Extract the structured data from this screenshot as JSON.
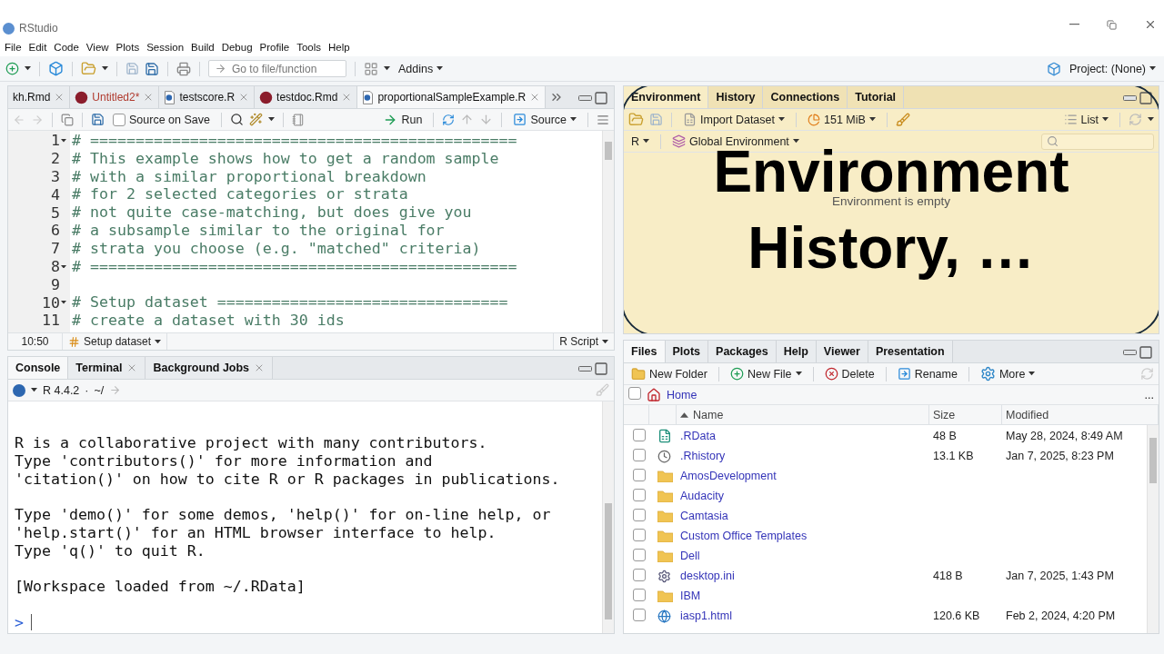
{
  "window": {
    "title": "RStudio"
  },
  "menu": [
    "File",
    "Edit",
    "Code",
    "View",
    "Plots",
    "Session",
    "Build",
    "Debug",
    "Profile",
    "Tools",
    "Help"
  ],
  "toolbar": {
    "goto_placeholder": "Go to file/function",
    "addins": "Addins",
    "project": "Project: (None)"
  },
  "editor": {
    "tabs": [
      {
        "label": "kh.Rmd",
        "selected": false,
        "modified": false
      },
      {
        "label": "Untitled2*",
        "kind": "rmd",
        "selected": false,
        "modified": true
      },
      {
        "label": "testscore.R",
        "kind": "r",
        "selected": false,
        "modified": false
      },
      {
        "label": "testdoc.Rmd",
        "kind": "rmd",
        "selected": false,
        "modified": false
      },
      {
        "label": "proportionalSampleExample.R",
        "kind": "r",
        "selected": true,
        "modified": false
      }
    ],
    "source_on_save": {
      "label": "Source on Save",
      "checked": false
    },
    "run": "Run",
    "source": "Source",
    "lines": [
      {
        "number": "1",
        "text": "# ===============================================",
        "fold": true
      },
      {
        "number": "2",
        "text": "# This example shows how to get a random sample",
        "fold": false
      },
      {
        "number": "3",
        "text": "# with a similar proportional breakdown",
        "fold": false
      },
      {
        "number": "4",
        "text": "# for 2 selected categories or strata",
        "fold": false
      },
      {
        "number": "5",
        "text": "# not quite case-matching, but does give you",
        "fold": false
      },
      {
        "number": "6",
        "text": "# a subsample similar to the original for",
        "fold": false
      },
      {
        "number": "7",
        "text": "# strata you choose (e.g. \"matched\" criteria)",
        "fold": false
      },
      {
        "number": "8",
        "text": "# ===============================================",
        "fold": true
      },
      {
        "number": "9",
        "fold": false
      },
      {
        "number": "10",
        "text": "# Setup dataset ================================",
        "fold": true
      },
      {
        "number": "11",
        "text": "# create a dataset with 30 ids",
        "fold": false
      }
    ],
    "status": {
      "position": "10:50",
      "section": "Setup dataset",
      "type": "R Script"
    }
  },
  "console": {
    "tabs": [
      {
        "label": "Console",
        "selected": true,
        "closable": false
      },
      {
        "label": "Terminal",
        "selected": false,
        "closable": true
      },
      {
        "label": "Background Jobs",
        "selected": false,
        "closable": true
      }
    ],
    "version": "R 4.4.2",
    "separator": "·",
    "path": "~/",
    "paragraphs": [
      [
        "R is a collaborative project with many contributors.",
        "Type 'contributors()' for more information and",
        "'citation()' on how to cite R or R packages in publications."
      ],
      [
        "Type 'demo()' for some demos, 'help()' for on-line help, or",
        "'help.start()' for an HTML browser interface to help.",
        "Type 'q()' to quit R."
      ],
      [
        "[Workspace loaded from ~/.RData]"
      ]
    ],
    "prompt": ">"
  },
  "environment": {
    "tabs": [
      {
        "label": "Environment",
        "selected": true
      },
      {
        "label": "History",
        "selected": false
      },
      {
        "label": "Connections",
        "selected": false
      },
      {
        "label": "Tutorial",
        "selected": false
      }
    ],
    "import": "Import Dataset",
    "memory": "151 MiB",
    "view": "List",
    "language": "R",
    "scope": "Global Environment",
    "empty": "Environment is empty"
  },
  "callout": {
    "lines": [
      "Environment",
      "History, …"
    ]
  },
  "files": {
    "tabs": [
      {
        "label": "Files",
        "selected": true
      },
      {
        "label": "Plots",
        "selected": false
      },
      {
        "label": "Packages",
        "selected": false
      },
      {
        "label": "Help",
        "selected": false
      },
      {
        "label": "Viewer",
        "selected": false
      },
      {
        "label": "Presentation",
        "selected": false
      }
    ],
    "actions": [
      {
        "label": "New Folder",
        "kind": "new-folder"
      },
      {
        "label": "New File",
        "kind": "new-file"
      },
      {
        "label": "Delete",
        "kind": "delete"
      },
      {
        "label": "Rename",
        "kind": "rename"
      },
      {
        "label": "More",
        "kind": "more"
      }
    ],
    "path": "Home",
    "more_path": "...",
    "select_all": false,
    "columns": [
      "Name",
      "Size",
      "Modified"
    ],
    "rows": [
      {
        "name": ".RData",
        "size": "48 B",
        "modified": "May 28, 2024, 8:49 AM",
        "kind": "rdata",
        "checked": false
      },
      {
        "name": ".Rhistory",
        "size": "13.1 KB",
        "modified": "Jan 7, 2025, 8:23 PM",
        "kind": "history",
        "checked": false
      },
      {
        "name": "AmosDevelopment",
        "kind": "folder",
        "checked": false
      },
      {
        "name": "Audacity",
        "kind": "folder",
        "checked": false
      },
      {
        "name": "Camtasia",
        "kind": "folder",
        "checked": false
      },
      {
        "name": "Custom Office Templates",
        "kind": "folder",
        "checked": false
      },
      {
        "name": "Dell",
        "kind": "folder",
        "checked": false
      },
      {
        "name": "desktop.ini",
        "size": "418 B",
        "modified": "Jan 7, 2025, 1:43 PM",
        "kind": "ini",
        "checked": false
      },
      {
        "name": "IBM",
        "kind": "folder",
        "checked": false
      },
      {
        "name": "iasp1.html",
        "size": "120.6 KB",
        "modified": "Feb 2, 2024, 4:20 PM",
        "kind": "html",
        "checked": false
      }
    ]
  }
}
